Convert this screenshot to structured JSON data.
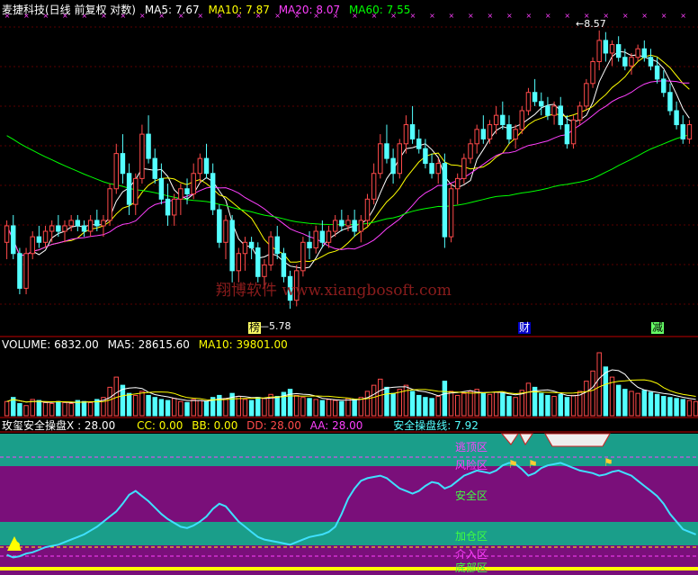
{
  "colors": {
    "background": "#000000",
    "up": "#ff4a4a",
    "down": "#54ffff",
    "ma5": "#ffffff",
    "ma10": "#ffff00",
    "ma20": "#ff40ff",
    "ma60": "#00ff00",
    "separator": "#c00000",
    "zone_green": "#1a9e8a",
    "zone_purple": "#7a0f7a",
    "osc_line": "#3fe0ff",
    "zone_text_magenta": "#ff40ff",
    "zone_text_green": "#3fff3f",
    "yellow": "#ffff00",
    "watermark": "#8a1c1c"
  },
  "price_panel": {
    "title": "麦捷科技(日线 前复权 对数)",
    "ma5": {
      "label": "MA5:",
      "value": "7.67"
    },
    "ma10": {
      "label": "MA10:",
      "value": "7.87"
    },
    "ma20": {
      "label": "MA20:",
      "value": "8.07"
    },
    "ma60": {
      "label": "MA60:",
      "value": "7.55"
    },
    "high_label": "8.57",
    "low_label": "5.78",
    "watermark": "翔博软件 www.xiangbosoft.com",
    "markers": [
      "榜",
      "财",
      "减"
    ]
  },
  "volume_panel": {
    "volume": {
      "label": "VOLUME:",
      "value": "6832.00"
    },
    "ma5": {
      "label": "MA5:",
      "value": "28615.60"
    },
    "ma10": {
      "label": "MA10:",
      "value": "39801.00"
    }
  },
  "indicator_panel": {
    "name": "玫玺安全操盘X",
    "value": ": 28.00",
    "cc": "CC: 0.00",
    "bb": "BB: 0.00",
    "dd": "DD: 28.00",
    "aa": "AA: 28.00",
    "line_label": "安全操盘线: 7.92",
    "zones": [
      "逃顶区",
      "风险区",
      "安全区",
      "加仓区",
      "介入区",
      "底部区"
    ]
  },
  "chart_data": [
    {
      "type": "candlestick",
      "title": "麦捷科技(日线 前复权 对数)",
      "ylim": [
        5.6,
        8.7
      ],
      "log_scale": true,
      "annotations": [
        {
          "text": "8.57",
          "kind": "high"
        },
        {
          "text": "5.78",
          "kind": "low"
        }
      ],
      "series": [
        {
          "name": "MA5",
          "last": 7.67
        },
        {
          "name": "MA10",
          "last": 7.87
        },
        {
          "name": "MA20",
          "last": 8.07
        },
        {
          "name": "MA60",
          "last": 7.55
        }
      ],
      "candles": [
        [
          6.35,
          6.55,
          6.2,
          6.5
        ],
        [
          6.5,
          6.6,
          6.2,
          6.25
        ],
        [
          6.25,
          6.3,
          5.9,
          5.95
        ],
        [
          5.95,
          6.3,
          5.9,
          6.25
        ],
        [
          6.25,
          6.45,
          6.2,
          6.4
        ],
        [
          6.4,
          6.5,
          6.3,
          6.35
        ],
        [
          6.35,
          6.5,
          6.3,
          6.45
        ],
        [
          6.45,
          6.55,
          6.35,
          6.5
        ],
        [
          6.5,
          6.6,
          6.4,
          6.45
        ],
        [
          6.45,
          6.55,
          6.35,
          6.5
        ],
        [
          6.5,
          6.6,
          6.45,
          6.55
        ],
        [
          6.55,
          6.6,
          6.45,
          6.5
        ],
        [
          6.5,
          6.55,
          6.4,
          6.45
        ],
        [
          6.45,
          6.6,
          6.4,
          6.55
        ],
        [
          6.55,
          6.65,
          6.45,
          6.5
        ],
        [
          6.5,
          6.6,
          6.4,
          6.55
        ],
        [
          6.55,
          6.9,
          6.5,
          6.85
        ],
        [
          6.85,
          7.3,
          6.8,
          7.2
        ],
        [
          7.2,
          7.4,
          6.9,
          7.0
        ],
        [
          7.0,
          7.1,
          6.6,
          6.7
        ],
        [
          6.7,
          7.0,
          6.6,
          6.95
        ],
        [
          6.95,
          7.5,
          6.9,
          7.4
        ],
        [
          7.4,
          7.6,
          7.1,
          7.15
        ],
        [
          7.15,
          7.25,
          6.9,
          6.95
        ],
        [
          6.95,
          7.1,
          6.7,
          6.75
        ],
        [
          6.75,
          6.9,
          6.5,
          6.6
        ],
        [
          6.6,
          6.8,
          6.5,
          6.75
        ],
        [
          6.75,
          6.9,
          6.6,
          6.85
        ],
        [
          6.85,
          6.95,
          6.7,
          6.8
        ],
        [
          6.8,
          7.1,
          6.75,
          7.0
        ],
        [
          7.0,
          7.2,
          6.9,
          7.15
        ],
        [
          7.15,
          7.3,
          6.95,
          7.0
        ],
        [
          7.0,
          7.1,
          6.6,
          6.65
        ],
        [
          6.65,
          6.7,
          6.3,
          6.35
        ],
        [
          6.35,
          6.6,
          6.2,
          6.55
        ],
        [
          6.55,
          6.6,
          6.0,
          6.1
        ],
        [
          6.1,
          6.3,
          6.0,
          6.25
        ],
        [
          6.25,
          6.4,
          6.1,
          6.35
        ],
        [
          6.35,
          6.4,
          6.2,
          6.3
        ],
        [
          6.3,
          6.35,
          6.0,
          6.05
        ],
        [
          6.05,
          6.2,
          5.95,
          6.15
        ],
        [
          6.15,
          6.45,
          6.1,
          6.4
        ],
        [
          6.4,
          6.5,
          6.2,
          6.25
        ],
        [
          6.25,
          6.3,
          6.0,
          6.05
        ],
        [
          6.05,
          6.1,
          5.78,
          5.85
        ],
        [
          5.85,
          6.15,
          5.8,
          6.1
        ],
        [
          6.1,
          6.4,
          6.05,
          6.35
        ],
        [
          6.35,
          6.45,
          6.2,
          6.3
        ],
        [
          6.3,
          6.5,
          6.25,
          6.45
        ],
        [
          6.45,
          6.55,
          6.3,
          6.35
        ],
        [
          6.35,
          6.5,
          6.3,
          6.45
        ],
        [
          6.45,
          6.6,
          6.4,
          6.55
        ],
        [
          6.55,
          6.65,
          6.45,
          6.5
        ],
        [
          6.5,
          6.6,
          6.45,
          6.55
        ],
        [
          6.55,
          6.65,
          6.4,
          6.45
        ],
        [
          6.45,
          6.6,
          6.35,
          6.55
        ],
        [
          6.55,
          6.8,
          6.5,
          6.75
        ],
        [
          6.75,
          7.1,
          6.7,
          7.0
        ],
        [
          7.0,
          7.4,
          6.95,
          7.3
        ],
        [
          7.3,
          7.5,
          7.1,
          7.15
        ],
        [
          7.15,
          7.25,
          6.9,
          7.0
        ],
        [
          7.0,
          7.35,
          6.95,
          7.3
        ],
        [
          7.3,
          7.6,
          7.2,
          7.5
        ],
        [
          7.5,
          7.7,
          7.3,
          7.35
        ],
        [
          7.35,
          7.45,
          7.2,
          7.25
        ],
        [
          7.25,
          7.35,
          7.05,
          7.1
        ],
        [
          7.1,
          7.2,
          6.95,
          7.0
        ],
        [
          7.0,
          7.15,
          6.9,
          7.1
        ],
        [
          7.1,
          7.2,
          6.3,
          6.4
        ],
        [
          6.4,
          6.9,
          6.35,
          6.85
        ],
        [
          6.85,
          7.0,
          6.7,
          6.95
        ],
        [
          6.95,
          7.2,
          6.9,
          7.15
        ],
        [
          7.15,
          7.35,
          7.1,
          7.3
        ],
        [
          7.3,
          7.5,
          7.2,
          7.45
        ],
        [
          7.45,
          7.6,
          7.3,
          7.35
        ],
        [
          7.35,
          7.55,
          7.3,
          7.5
        ],
        [
          7.5,
          7.7,
          7.4,
          7.6
        ],
        [
          7.6,
          7.75,
          7.45,
          7.5
        ],
        [
          7.5,
          7.6,
          7.3,
          7.35
        ],
        [
          7.35,
          7.5,
          7.25,
          7.45
        ],
        [
          7.45,
          7.7,
          7.4,
          7.65
        ],
        [
          7.65,
          7.9,
          7.6,
          7.85
        ],
        [
          7.85,
          8.0,
          7.7,
          7.75
        ],
        [
          7.75,
          7.85,
          7.6,
          7.7
        ],
        [
          7.7,
          7.8,
          7.55,
          7.6
        ],
        [
          7.6,
          7.75,
          7.5,
          7.7
        ],
        [
          7.7,
          7.8,
          7.45,
          7.5
        ],
        [
          7.5,
          7.6,
          7.25,
          7.3
        ],
        [
          7.3,
          7.6,
          7.25,
          7.55
        ],
        [
          7.55,
          7.75,
          7.5,
          7.7
        ],
        [
          7.7,
          8.0,
          7.65,
          7.95
        ],
        [
          7.95,
          8.25,
          7.9,
          8.2
        ],
        [
          8.2,
          8.57,
          8.1,
          8.45
        ],
        [
          8.45,
          8.55,
          8.2,
          8.3
        ],
        [
          8.3,
          8.45,
          8.15,
          8.4
        ],
        [
          8.4,
          8.5,
          8.2,
          8.25
        ],
        [
          8.25,
          8.35,
          8.1,
          8.15
        ],
        [
          8.15,
          8.3,
          8.05,
          8.25
        ],
        [
          8.25,
          8.4,
          8.2,
          8.35
        ],
        [
          8.35,
          8.45,
          8.2,
          8.25
        ],
        [
          8.25,
          8.35,
          8.1,
          8.15
        ],
        [
          8.15,
          8.25,
          7.95,
          8.0
        ],
        [
          8.0,
          8.1,
          7.8,
          7.85
        ],
        [
          7.85,
          7.95,
          7.6,
          7.65
        ],
        [
          7.65,
          7.75,
          7.45,
          7.5
        ],
        [
          7.5,
          7.6,
          7.3,
          7.35
        ],
        [
          7.35,
          7.55,
          7.3,
          7.5
        ]
      ]
    },
    {
      "type": "bar",
      "title": "VOLUME",
      "values": [
        14,
        18,
        12,
        10,
        16,
        15,
        13,
        12,
        14,
        13,
        12,
        15,
        14,
        13,
        16,
        18,
        28,
        38,
        30,
        22,
        20,
        24,
        20,
        18,
        16,
        15,
        17,
        14,
        13,
        16,
        15,
        14,
        18,
        20,
        17,
        22,
        19,
        16,
        15,
        18,
        17,
        21,
        19,
        23,
        26,
        20,
        18,
        17,
        16,
        15,
        16,
        15,
        14,
        17,
        16,
        18,
        24,
        30,
        36,
        28,
        22,
        26,
        30,
        24,
        20,
        18,
        17,
        19,
        34,
        24,
        20,
        22,
        24,
        26,
        22,
        21,
        23,
        22,
        19,
        18,
        25,
        32,
        28,
        22,
        20,
        19,
        21,
        18,
        20,
        24,
        34,
        44,
        62,
        48,
        38,
        30,
        26,
        24,
        22,
        25,
        23,
        21,
        19,
        18,
        17,
        16,
        15,
        14
      ],
      "ma5_last": 28615.6,
      "ma10_last": 39801.0
    },
    {
      "type": "line",
      "title": "玫玺安全操盘X",
      "ylim": [
        0,
        100
      ],
      "series": [
        {
          "name": "安全操盘线",
          "last": 7.92,
          "values": [
            8,
            6,
            7,
            9,
            10,
            12,
            14,
            15,
            16,
            18,
            20,
            22,
            24,
            27,
            30,
            34,
            38,
            42,
            48,
            55,
            58,
            54,
            50,
            45,
            40,
            36,
            33,
            30,
            29,
            31,
            34,
            38,
            44,
            48,
            46,
            40,
            34,
            30,
            26,
            22,
            20,
            19,
            18,
            17,
            16,
            18,
            20,
            22,
            23,
            24,
            26,
            30,
            40,
            52,
            60,
            66,
            68,
            69,
            70,
            68,
            64,
            60,
            58,
            56,
            58,
            62,
            65,
            64,
            60,
            62,
            66,
            70,
            72,
            74,
            73,
            72,
            74,
            78,
            80,
            79,
            75,
            70,
            72,
            76,
            78,
            79,
            80,
            78,
            76,
            74,
            73,
            72,
            70,
            71,
            73,
            74,
            72,
            70,
            66,
            62,
            58,
            54,
            48,
            40,
            34,
            28,
            26,
            24
          ]
        }
      ],
      "zones": [
        "逃顶区",
        "风险区",
        "安全区",
        "加仓区",
        "介入区",
        "底部区"
      ]
    }
  ]
}
